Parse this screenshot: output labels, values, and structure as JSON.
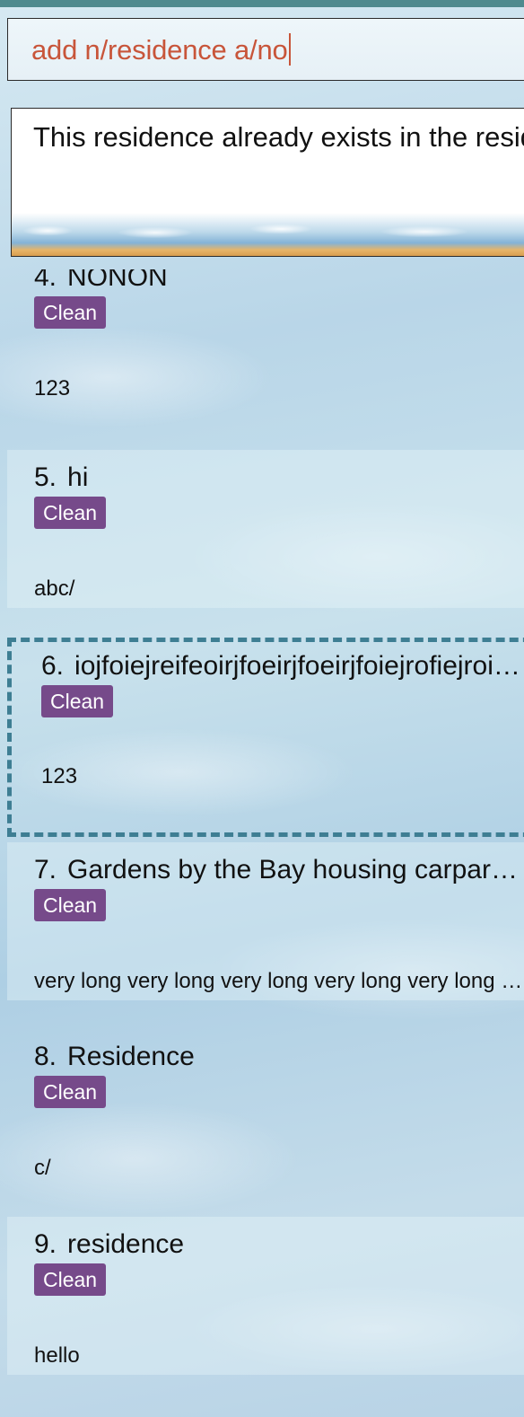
{
  "command_box": {
    "value": "add n/residence a/no"
  },
  "result_display": {
    "message": "This residence already exists in the residence tracker"
  },
  "residences": [
    {
      "index": "4.",
      "name": "NONON",
      "tag": "Clean",
      "address": "123"
    },
    {
      "index": "5.",
      "name": "hi",
      "tag": "Clean",
      "address": "abc/"
    },
    {
      "index": "6.",
      "name": "iojfoiejreifeoirjfoeirjfoeirjfoiejrofiejroifeoirjfoeirjfoei",
      "tag": "Clean",
      "address": "123"
    },
    {
      "index": "7.",
      "name": "Gardens by the Bay housing carpark area residence",
      "tag": "Clean",
      "address": "very long very long very long very long very long very long"
    },
    {
      "index": "8.",
      "name": "Residence",
      "tag": "Clean",
      "address": "c/"
    },
    {
      "index": "9.",
      "name": "residence",
      "tag": "Clean",
      "address": "hello"
    }
  ],
  "colors": {
    "accent_stripe": "#4f8a8e",
    "command_text": "#c8553a",
    "tag_background": "#764a8a",
    "selection_border": "#3e7e93"
  }
}
